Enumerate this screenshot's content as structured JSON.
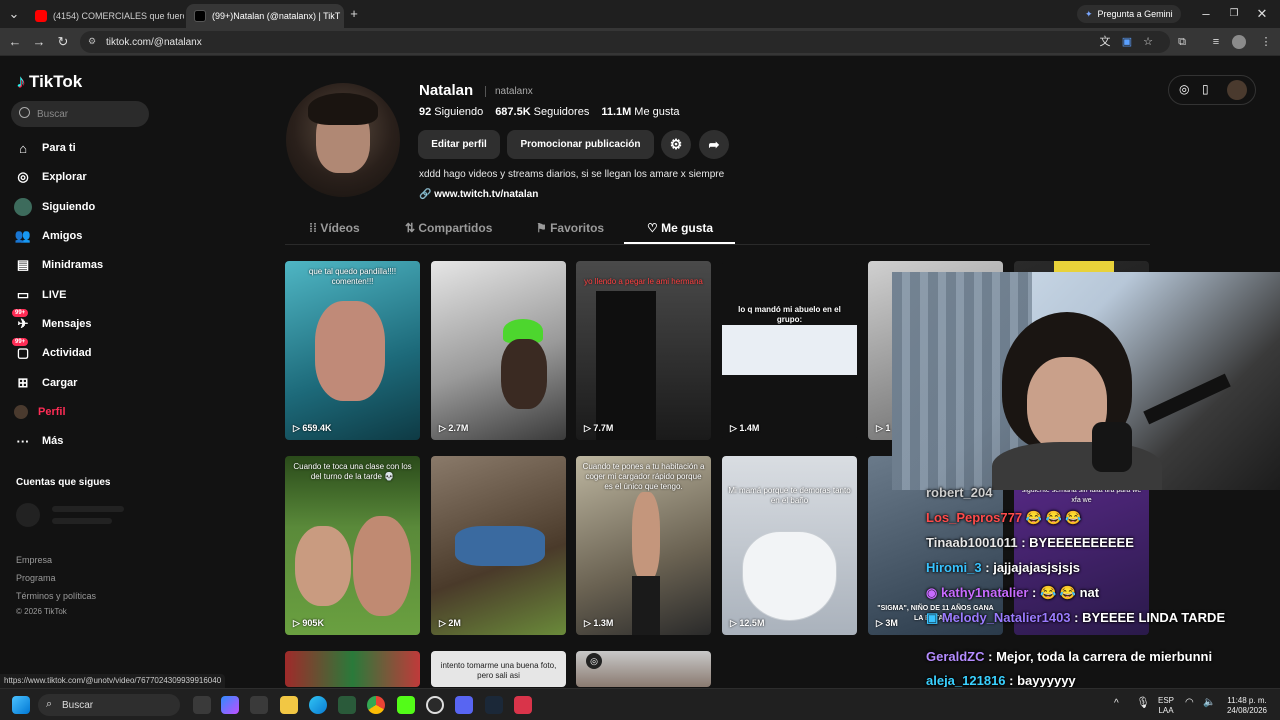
{
  "browser": {
    "tabs": [
      {
        "title": "(4154) COMERCIALES que fuero",
        "active": false
      },
      {
        "title": "(99+)Natalan (@natalanx) | TikT",
        "active": true
      }
    ],
    "new_tab": "+",
    "url": "tiktok.com/@natalanx",
    "gemini": "Pregunta a Gemini",
    "status_url": "https://www.tiktok.com/@unotv/video/7677024309939916040"
  },
  "sidebar": {
    "brand": "TikTok",
    "search_placeholder": "Buscar",
    "items": [
      {
        "label": "Para ti",
        "icon": "home-icon"
      },
      {
        "label": "Explorar",
        "icon": "compass-icon"
      },
      {
        "label": "Siguiendo",
        "icon": "following-avatar-icon"
      },
      {
        "label": "Amigos",
        "icon": "friends-icon"
      },
      {
        "label": "Minidramas",
        "icon": "minidrama-icon"
      },
      {
        "label": "LIVE",
        "icon": "live-icon"
      },
      {
        "label": "Mensajes",
        "icon": "message-icon",
        "badge": "99+"
      },
      {
        "label": "Actividad",
        "icon": "activity-icon",
        "badge": "99+"
      },
      {
        "label": "Cargar",
        "icon": "upload-icon"
      },
      {
        "label": "Perfil",
        "icon": "profile-avatar-icon",
        "active": true
      },
      {
        "label": "Más",
        "icon": "more-icon"
      }
    ],
    "following_header": "Cuentas que sigues",
    "footer": [
      "Empresa",
      "Programa",
      "Términos y políticas",
      "© 2026 TikTok"
    ]
  },
  "profile": {
    "name": "Natalan",
    "handle": "natalanx",
    "following_count": "92",
    "following_label": "Siguiendo",
    "followers_count": "687.5K",
    "followers_label": "Seguidores",
    "likes_count": "11.1M",
    "likes_label": "Me gusta",
    "edit_button": "Editar perfil",
    "promote_button": "Promocionar publicación",
    "bio": "xddd hago videos y streams diarios, si se llegan los amare x siempre",
    "link": "www.twitch.tv/natalan",
    "tabs": [
      "Vídeos",
      "Compartidos",
      "Favoritos",
      "Me gusta"
    ],
    "active_tab": "Me gusta"
  },
  "videos": [
    {
      "caption": "que tal quedo pandilla!!!! comenten!!!",
      "views": "659.4K"
    },
    {
      "caption": "",
      "views": "2.7M"
    },
    {
      "caption": "yo llendo a pegar le ami hermana",
      "views": "7.7M"
    },
    {
      "caption": "lo q mandó mi abuelo en el grupo:",
      "views": "1.4M"
    },
    {
      "caption": "",
      "views": "1"
    },
    {
      "caption": "",
      "views": ""
    },
    {
      "caption": "Cuando te toca una clase con los del turno de la tarde 💀",
      "views": "905K"
    },
    {
      "caption": "",
      "views": "2M"
    },
    {
      "caption": "Cuando te pones a tu habitación a coger mi cargador rápido porque es el único que tengo.",
      "views": "1.3M"
    },
    {
      "caption": "Mi mamá porque te demoras tanto en el baño",
      "views": "12.5M"
    },
    {
      "caption": "\"SIGMA\", NIÑO DE 11 AÑOS GANA LA BATALLA",
      "views": "3M"
    },
    {
      "caption": "siguiente semana sin falta tira para we xfa we",
      "views": ""
    },
    {
      "caption": "",
      "views": ""
    },
    {
      "caption": "intento tomarme una buena foto, pero sali asi",
      "views": ""
    },
    {
      "caption": "",
      "views": ""
    }
  ],
  "chat": [
    {
      "user": "robert_204",
      "msg": "",
      "color": "#cfcfcf"
    },
    {
      "user": "Los_Pepros777",
      "msg": "😂 😂 😂",
      "color": "#ff4b4b"
    },
    {
      "user": "Tinaab1001011",
      "msg": ": BYEEEEEEEEEE",
      "color": "#e8e8e8"
    },
    {
      "user": "Hiromi_3",
      "msg": ": jajjajajasjsjsjs",
      "color": "#39c3ff"
    },
    {
      "user": "kathy1natalier",
      "msg": ": 😂 😂 nat",
      "color": "#c86bff"
    },
    {
      "user": "Melody_Natalier1403",
      "msg": ": BYEEEE LINDA TARDE",
      "color": "#9b7bff"
    },
    {
      "user": "GeraldZC",
      "msg": ": Mejor, toda la carrera de mierbunni",
      "color": "#b48cff"
    },
    {
      "user": "aleja_121816",
      "msg": ": bayyyyyy",
      "color": "#3ad1ff"
    }
  ],
  "taskbar": {
    "search": "Buscar",
    "lang": "ESP",
    "lang2": "LAA",
    "time": "11:48 p. m.",
    "date": "24/08/2026"
  },
  "colors": {
    "accent": "#fe2c55",
    "page_bg": "#121212",
    "chrome_bg": "#1f1f1f"
  }
}
